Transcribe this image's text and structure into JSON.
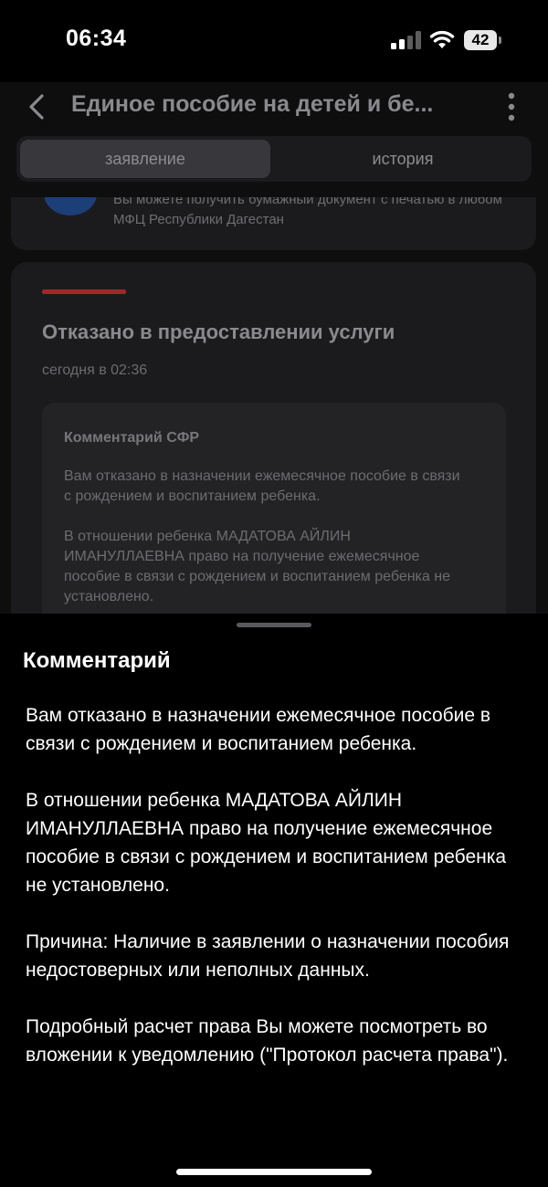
{
  "status_bar": {
    "time": "06:34",
    "battery": "42"
  },
  "header": {
    "title": "Единое пособие на детей и бе..."
  },
  "tabs": [
    {
      "label": "заявление",
      "active": true
    },
    {
      "label": "история",
      "active": false
    }
  ],
  "top_card": {
    "text": "Вы можете получить бумажный документ с печатью в любом МФЦ Республики Дагестан"
  },
  "status_card": {
    "title": "Отказано в предоставлении услуги",
    "date": "сегодня в 02:36",
    "comment_title": "Комментарий СФР",
    "comment_paragraphs": [
      "Вам отказано в назначении ежемесячное пособие в связи с рождением и воспитанием ребенка.",
      "В отношении ребенка МАДАТОВА АЙЛИН ИМАНУЛЛАЕВНА право на получение ежемесячное пособие в связи с рождением и воспитанием ребенка не установлено."
    ],
    "accent_color": "#9f2929"
  },
  "sheet": {
    "title": "Комментарий",
    "paragraphs": [
      "Вам отказано в назначении ежемесячное пособие в связи с рождением и воспитанием ребенка.",
      "В отношении ребенка МАДАТОВА АЙЛИН ИМАНУЛЛАЕВНА право на получение ежемесячное пособие в связи с рождением и воспитанием ребенка не установлено.",
      "Причина: Наличие в заявлении о назначении пособия недостоверных или неполных данных.",
      "Подробный расчет права Вы можете посмотреть во вложении к уведомлению (\"Протокол расчета права\")."
    ]
  },
  "icons": {
    "back": "chevron-left-icon",
    "more": "more-vertical-icon",
    "signal": "cellular-signal-icon",
    "wifi": "wifi-icon",
    "battery": "battery-icon"
  }
}
